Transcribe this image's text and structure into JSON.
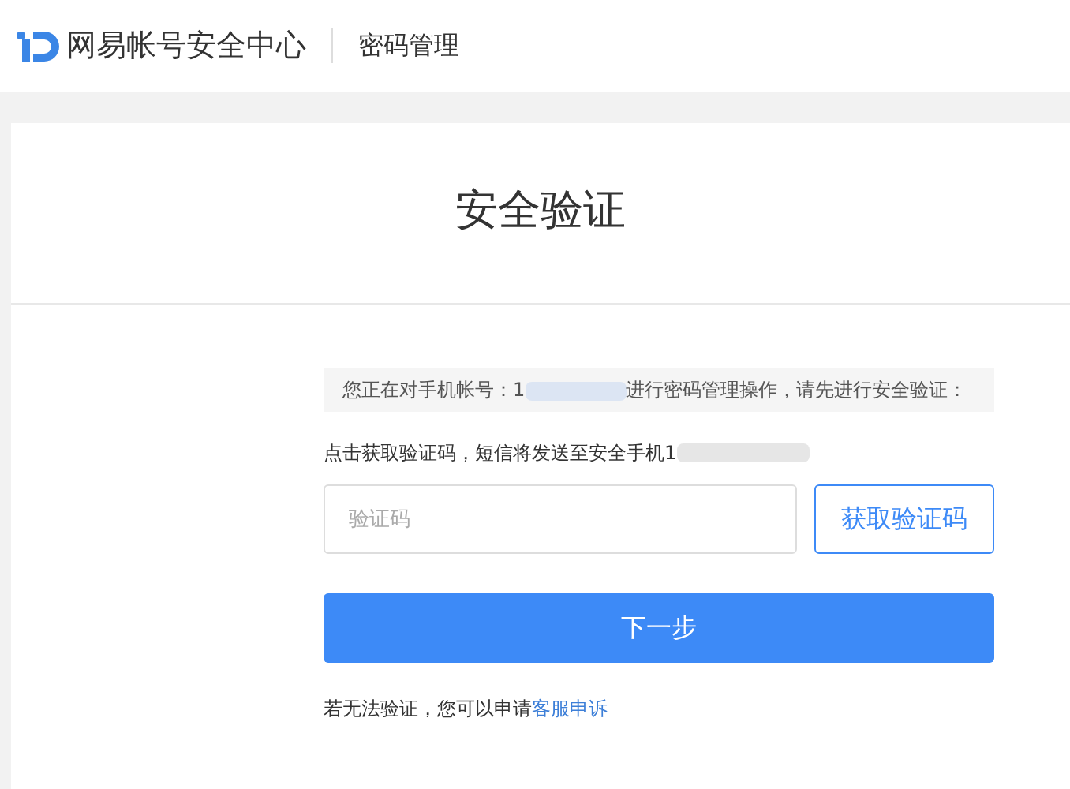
{
  "header": {
    "brand": "网易帐号安全中心",
    "section": "密码管理"
  },
  "page_title": "安全验证",
  "notice": {
    "before": "您正在对手机帐号：1",
    "after": "进行密码管理操作，请先进行安全验证："
  },
  "sms_hint": {
    "before": "点击获取验证码，短信将发送至安全手机1"
  },
  "code_field": {
    "placeholder": "验证码"
  },
  "get_code_button": "获取验证码",
  "next_button": "下一步",
  "footer": {
    "text": "若无法验证，您可以申请",
    "link": "客服申诉"
  }
}
